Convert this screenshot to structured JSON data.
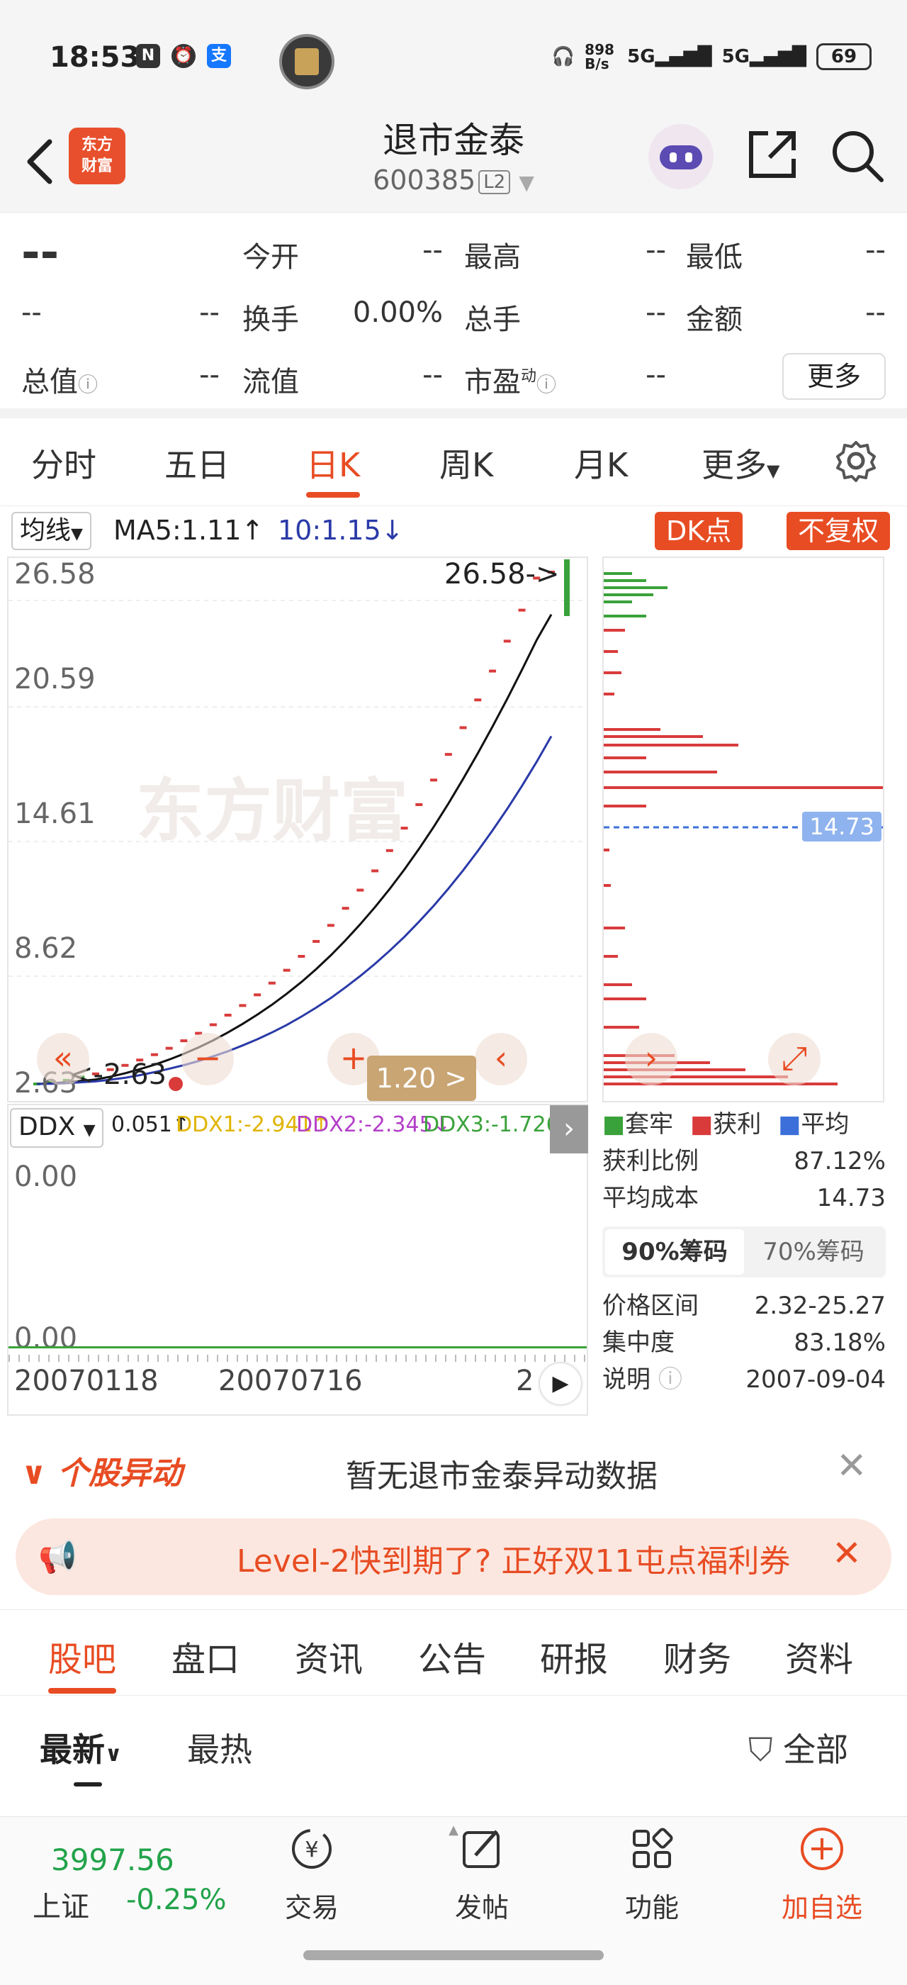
{
  "status_bar": {
    "time": "18:53",
    "icons": [
      "nfc-icon",
      "alarm-icon",
      "alipay-icon"
    ],
    "net_speed": "898 B/s",
    "signal_1": "5G",
    "signal_2": "5G",
    "battery": "69"
  },
  "header": {
    "logo_line1": "东方",
    "logo_line2": "财富",
    "title": "退市金泰",
    "code": "600385",
    "level": "L2"
  },
  "quote": {
    "price": "--",
    "change": "--",
    "change_pct": "--",
    "open_label": "今开",
    "open": "--",
    "high_label": "最高",
    "high": "--",
    "low_label": "最低",
    "low": "--",
    "turnover_label": "换手",
    "turnover": "0.00%",
    "volume_label": "总手",
    "volume": "--",
    "amount_label": "金额",
    "amount": "--",
    "mktcap_label": "总值",
    "mktcap": "--",
    "float_label": "流值",
    "float_value": "--",
    "pe_label": "市盈",
    "pe_sup": "动",
    "pe": "--",
    "more_label": "更多"
  },
  "kline_tabs": [
    "分时",
    "五日",
    "日K",
    "周K",
    "月K",
    "更多"
  ],
  "active_tab": "日K",
  "ma_bar": {
    "selector": "均线",
    "ma5": "MA5:1.11",
    "ma10": "10:1.15",
    "dk_label": "DK点",
    "fq_label": "不复权"
  },
  "chart": {
    "y_labels": [
      "26.58",
      "20.59",
      "14.61",
      "8.62",
      "2.63"
    ],
    "max_marker": "26.58->",
    "min_marker": "<-2.63",
    "zoom_label": "1.20 >",
    "watermark": "东方财富",
    "cost_line": "14.73",
    "nav": [
      "«",
      "−",
      "+",
      "‹",
      "›",
      "⤢"
    ]
  },
  "chart_data": {
    "type": "candlestick",
    "ylim": [
      2.63,
      26.58
    ],
    "close": [
      2.63,
      2.7,
      2.8,
      2.95,
      3.1,
      3.3,
      3.5,
      3.75,
      4.0,
      4.3,
      4.65,
      5.0,
      5.4,
      5.85,
      6.3,
      6.8,
      7.35,
      7.95,
      8.6,
      9.3,
      10.05,
      10.85,
      11.7,
      12.6,
      13.55,
      14.6,
      15.7,
      16.85,
      18.05,
      19.3,
      20.6,
      21.95,
      23.35,
      24.8,
      26.3,
      26.58
    ],
    "ma5": [
      2.63,
      2.66,
      2.71,
      2.77,
      2.84,
      2.97,
      3.13,
      3.32,
      3.53,
      3.77,
      4.04,
      4.34,
      4.67,
      5.04,
      5.44,
      5.87,
      6.34,
      6.85,
      7.4,
      8.0,
      8.65,
      9.35,
      10.1,
      10.9,
      11.75,
      12.66,
      13.63,
      14.66,
      15.75,
      16.9,
      18.1,
      19.35,
      20.65,
      22.0,
      23.4,
      24.6
    ],
    "ma10": [
      2.63,
      2.64,
      2.67,
      2.71,
      2.75,
      2.83,
      2.92,
      3.04,
      3.18,
      3.34,
      3.51,
      3.7,
      3.92,
      4.16,
      4.43,
      4.72,
      5.04,
      5.39,
      5.78,
      6.2,
      6.65,
      7.15,
      7.68,
      8.25,
      8.86,
      9.51,
      10.22,
      10.97,
      11.77,
      12.62,
      13.53,
      14.49,
      15.5,
      16.57,
      17.7,
      18.9
    ]
  },
  "ddx": {
    "selector": "DDX",
    "ddx": "0.051",
    "ddx1": "DDX1:-2.941",
    "ddx2": "DDX2:-2.345",
    "ddx3": "DDX3:-1.726",
    "y_top": "0.00",
    "y_bottom": "0.00",
    "date_1": "20070118",
    "date_2": "20070716",
    "date_3": "2"
  },
  "chips": {
    "legend_1": "套牢",
    "legend_2": "获利",
    "legend_3": "平均",
    "profit_ratio_label": "获利比例",
    "profit_ratio": "87.12%",
    "avg_cost_label": "平均成本",
    "avg_cost": "14.73",
    "tab_90": "90%筹码",
    "tab_70": "70%筹码",
    "range_label": "价格区间",
    "range": "2.32-25.27",
    "concentration_label": "集中度",
    "concentration": "83.18%",
    "note_label": "说明",
    "note_date": "2007-09-04",
    "colors": {
      "trapped": "#3aa23a",
      "profit": "#d93b3b",
      "average": "#3c6fd9"
    }
  },
  "abnormal": {
    "label": "个股异动",
    "message": "暂无退市金泰异动数据"
  },
  "promo": {
    "text": "Level-2快到期了? 正好双11屯点福利券"
  },
  "bottom_tabs": [
    "股吧",
    "盘口",
    "资讯",
    "公告",
    "研报",
    "财务",
    "资料"
  ],
  "sub_filter": {
    "latest": "最新",
    "hot": "最热",
    "all": "全部"
  },
  "bottom_nav": {
    "index_value": "3997.56",
    "index_name": "上证",
    "index_change": "-0.25%",
    "trade": "交易",
    "post": "发帖",
    "function": "功能",
    "add_watch": "加自选"
  }
}
